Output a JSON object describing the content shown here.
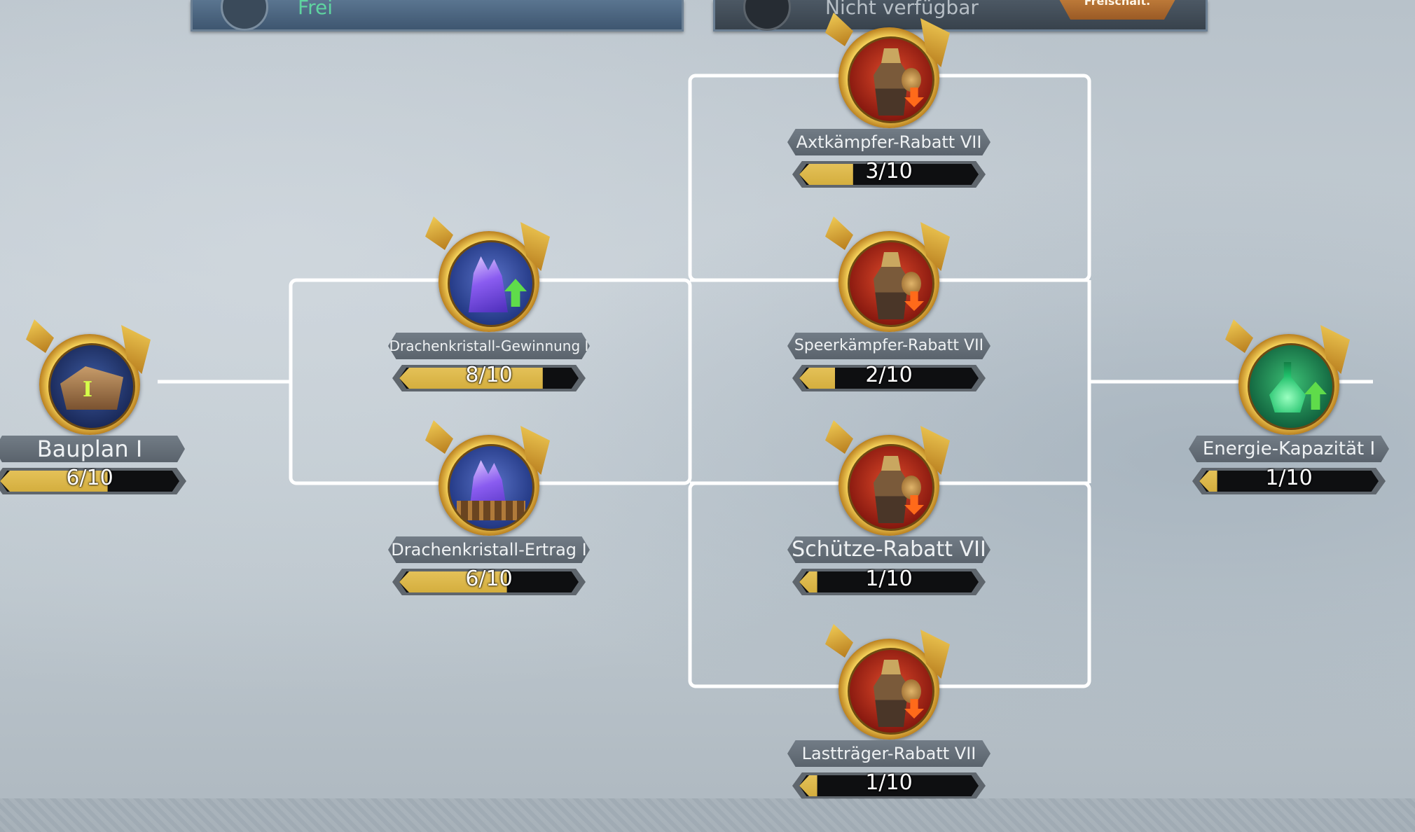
{
  "top_bar": {
    "left_status": "Frei",
    "right_status": "Nicht verfügbar",
    "unlock_button": "Freischalt."
  },
  "nodes": {
    "bauplan": {
      "name": "Bauplan I",
      "progress": "6/10",
      "level": 6,
      "max": 10
    },
    "gewinnung": {
      "name": "Drachenkristall-Gewinnung I",
      "progress": "8/10",
      "level": 8,
      "max": 10
    },
    "ertrag": {
      "name": "Drachenkristall-Ertrag I",
      "progress": "6/10",
      "level": 6,
      "max": 10
    },
    "axt": {
      "name": "Axtkämpfer-Rabatt VII",
      "progress": "3/10",
      "level": 3,
      "max": 10
    },
    "speer": {
      "name": "Speerkämpfer-Rabatt VII",
      "progress": "2/10",
      "level": 2,
      "max": 10
    },
    "schuetze": {
      "name": "Schütze-Rabatt VII",
      "progress": "1/10",
      "level": 1,
      "max": 10
    },
    "last": {
      "name": "Lastträger-Rabatt VII",
      "progress": "1/10",
      "level": 1,
      "max": 10
    },
    "energie": {
      "name": "Energie-Kapazität I",
      "progress": "1/10",
      "level": 1,
      "max": 10
    }
  },
  "colors": {
    "progress_fill": "#d4ae3e",
    "connector": "#ffffff",
    "free_status": "#5fd4a0"
  },
  "icons": {
    "bauplan": "blueprint-ship-icon",
    "gewinnung": "crystal-up-icon",
    "ertrag": "crystal-fence-icon",
    "axt": "axe-warrior-icon",
    "speer": "spear-warrior-icon",
    "schuetze": "archer-icon",
    "last": "porter-icon",
    "energie": "energy-potion-icon"
  }
}
